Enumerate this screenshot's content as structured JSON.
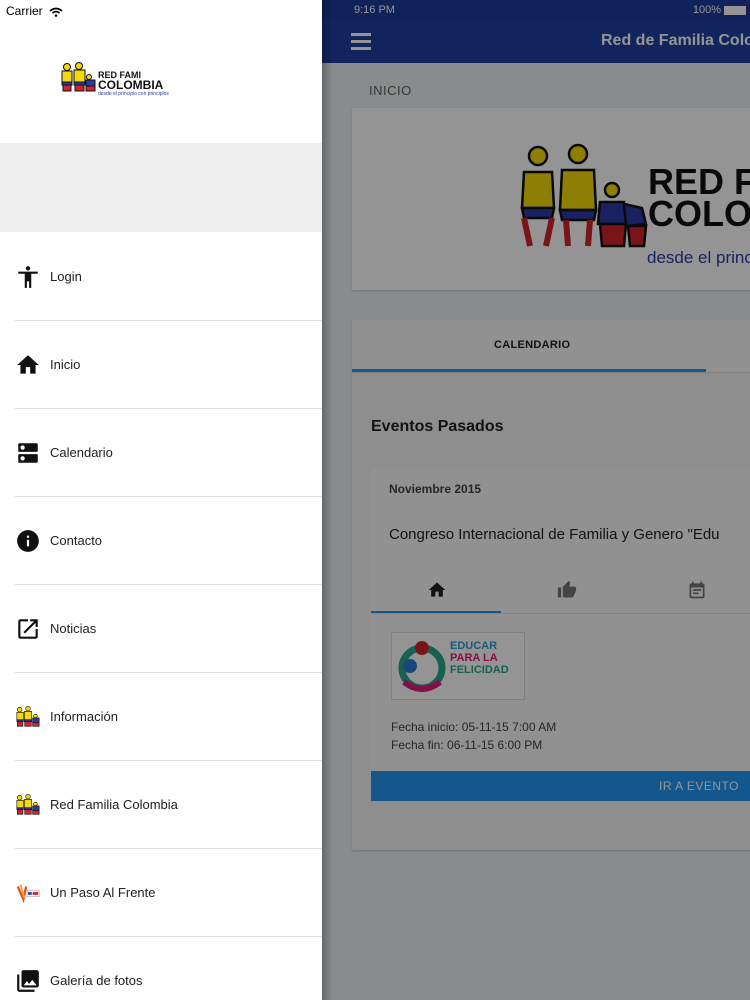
{
  "status_bar": {
    "carrier": "Carrier",
    "time": "9:16 PM",
    "battery": "100%"
  },
  "drawer": {
    "logo": {
      "line1": "RED FAMI",
      "line2": "COLOMBIA",
      "slogan": "desde el principio con principios"
    },
    "menu": [
      {
        "label": "Login",
        "icon": "person-icon"
      },
      {
        "label": "Inicio",
        "icon": "home-icon"
      },
      {
        "label": "Calendario",
        "icon": "dns-icon"
      },
      {
        "label": "Contacto",
        "icon": "info-icon"
      },
      {
        "label": "Noticias",
        "icon": "open-in-new-icon"
      },
      {
        "label": "Información",
        "icon": "family-logo-icon"
      },
      {
        "label": "Red Familia Colombia",
        "icon": "family-logo-icon"
      },
      {
        "label": "Un Paso Al Frente",
        "icon": "un-paso-logo-icon"
      },
      {
        "label": "Galería de fotos",
        "icon": "photo-icon"
      }
    ]
  },
  "main": {
    "app_title": "Red de Familia Colombia",
    "breadcrumb": "INICIO",
    "logo": {
      "line1": "RED FA",
      "line2": "COLO",
      "slogan": "desde el princi"
    },
    "tabs": [
      {
        "label": "CALENDARIO"
      }
    ],
    "section_title": "Eventos Pasados",
    "event": {
      "month": "Noviembre 2015",
      "title": "Congreso Internacional de Familia y Genero \"Edu",
      "logo_text": {
        "line1": "EDUCAR",
        "line2": "PARA LA",
        "line3": "FELICIDAD"
      },
      "start": "Fecha inicio: 05-11-15 7:00 AM",
      "end": "Fecha fin: 06-11-15 6:00 PM",
      "button": "IR A EVENTO"
    }
  },
  "colors": {
    "primary": "#1f3fa3",
    "accent": "#2196f3",
    "flag_yellow": "#f5d90a",
    "flag_blue": "#2c3aa8",
    "flag_red": "#d0232a"
  }
}
